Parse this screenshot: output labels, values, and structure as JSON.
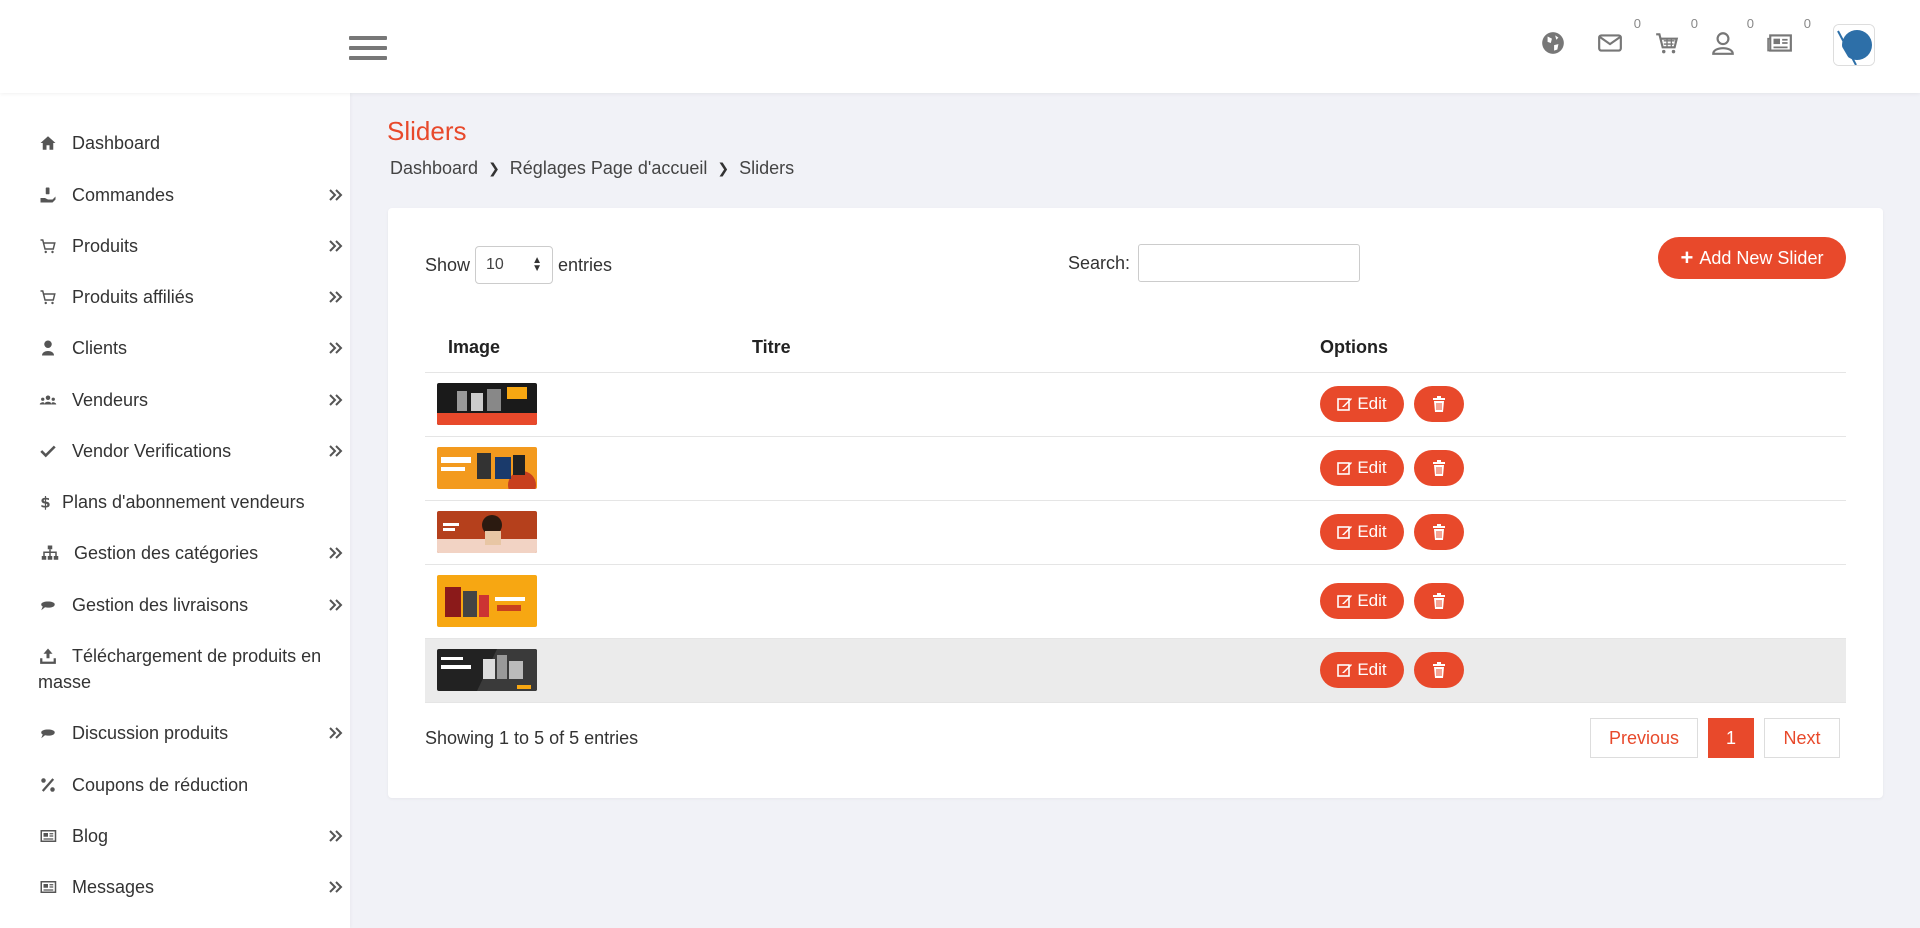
{
  "header": {
    "counts": {
      "mail": "0",
      "cart": "0",
      "user": "0",
      "news": "0"
    }
  },
  "sidebar": {
    "items": [
      {
        "label": "Dashboard",
        "icon": "home-icon",
        "arrow": false
      },
      {
        "label": "Commandes",
        "icon": "hand-holding-icon",
        "arrow": true
      },
      {
        "label": "Produits",
        "icon": "cart-icon",
        "arrow": true
      },
      {
        "label": "Produits affiliés",
        "icon": "cart-icon",
        "arrow": true
      },
      {
        "label": "Clients",
        "icon": "user-icon",
        "arrow": true
      },
      {
        "label": "Vendeurs",
        "icon": "users-icon",
        "arrow": true
      },
      {
        "label": "Vendor Verifications",
        "icon": "check-icon",
        "arrow": true
      },
      {
        "label": "Plans d'abonnement vendeurs",
        "icon": "dollar-icon",
        "arrow": false
      },
      {
        "label": "Gestion des catégories",
        "icon": "sitemap-icon",
        "arrow": true
      },
      {
        "label": "Gestion des livraisons",
        "icon": "chat-icon",
        "arrow": true
      },
      {
        "label": "Téléchargement de produits en masse",
        "icon": "upload-icon",
        "arrow": false
      },
      {
        "label": "Discussion produits",
        "icon": "chat-icon",
        "arrow": true
      },
      {
        "label": "Coupons de réduction",
        "icon": "percent-icon",
        "arrow": false
      },
      {
        "label": "Blog",
        "icon": "newspaper-icon",
        "arrow": true
      },
      {
        "label": "Messages",
        "icon": "newspaper-icon",
        "arrow": true
      }
    ]
  },
  "page": {
    "title": "Sliders",
    "breadcrumb": [
      "Dashboard",
      "Réglages Page d'accueil",
      "Sliders"
    ]
  },
  "table_controls": {
    "show_label": "Show",
    "entries_value": "10",
    "entries_label": "entries",
    "search_label": "Search:",
    "search_value": "",
    "add_button": "Add New Slider"
  },
  "table": {
    "headers": [
      "Image",
      "Titre",
      "Options"
    ],
    "rows": [
      {
        "title": "",
        "edit": "Edit",
        "thumb_color": "#1a1a1a",
        "accent": "#e8492b"
      },
      {
        "title": "",
        "edit": "Edit",
        "thumb_color": "#f39a1e",
        "accent": "#c8401e"
      },
      {
        "title": "",
        "edit": "Edit",
        "thumb_color": "#b5401c",
        "accent": "#f2d3c4"
      },
      {
        "title": "",
        "edit": "Edit",
        "thumb_color": "#f7a712",
        "accent": "#8b1a1a"
      },
      {
        "title": "",
        "edit": "Edit",
        "thumb_color": "#222222",
        "accent": "#f7a712"
      }
    ]
  },
  "footer": {
    "info": "Showing 1 to 5 of 5 entries",
    "previous": "Previous",
    "page": "1",
    "next": "Next"
  },
  "colors": {
    "accent": "#e8492b",
    "background": "#f1f2f7"
  }
}
